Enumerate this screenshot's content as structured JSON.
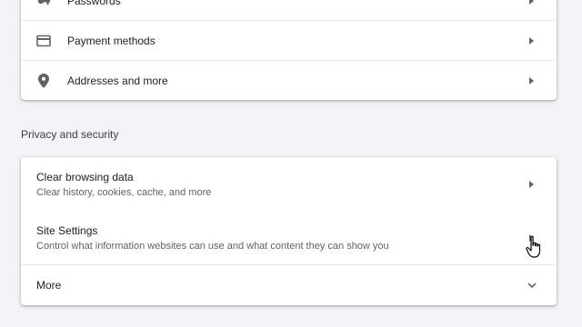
{
  "autofill": {
    "items": [
      {
        "label": "Passwords",
        "icon": "key-icon"
      },
      {
        "label": "Payment methods",
        "icon": "credit-card-icon"
      },
      {
        "label": "Addresses and more",
        "icon": "location-pin-icon"
      }
    ]
  },
  "privacy": {
    "section_title": "Privacy and security",
    "items": [
      {
        "title": "Clear browsing data",
        "subtitle": "Clear history, cookies, cache, and more"
      },
      {
        "title": "Site Settings",
        "subtitle": "Control what information websites can use and what content they can show you"
      }
    ],
    "more_label": "More"
  },
  "colors": {
    "background": "#f1f3f4",
    "card": "#ffffff",
    "icon": "#5f6368",
    "text_primary": "#202124",
    "text_secondary": "#5f6368",
    "divider": "#e8eaed"
  }
}
